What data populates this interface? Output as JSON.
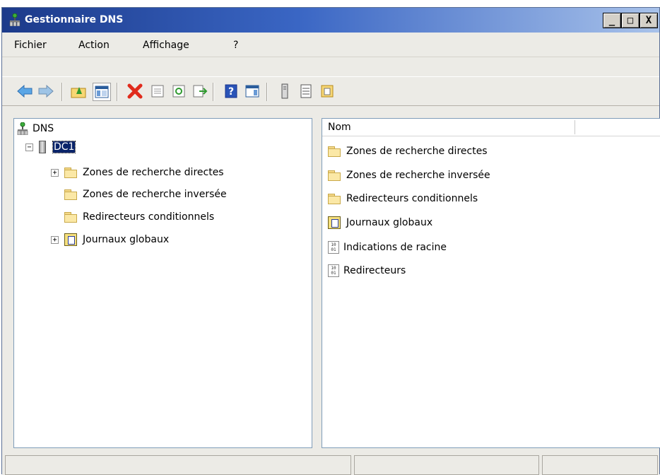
{
  "window": {
    "title": "Gestionnaire DNS",
    "buttons": {
      "minimize": "_",
      "maximize": "□",
      "close": "X"
    }
  },
  "menubar": {
    "items": [
      "Fichier",
      "Action",
      "Affichage",
      "?"
    ]
  },
  "toolbar": {
    "buttons": [
      "back-icon",
      "forward-icon",
      "up-folder-icon",
      "show-hide-tree-icon",
      "delete-icon",
      "properties-icon",
      "refresh-icon",
      "export-list-icon",
      "help-icon",
      "show-action-pane-icon",
      "server-icon",
      "list-view-icon",
      "new-window-icon"
    ]
  },
  "tree": {
    "root": "DNS",
    "server": "DC1",
    "items": [
      {
        "label": "Zones de recherche directes",
        "expandable": true
      },
      {
        "label": "Zones de recherche inversée",
        "expandable": false
      },
      {
        "label": "Redirecteurs conditionnels",
        "expandable": false
      },
      {
        "label": "Journaux globaux",
        "expandable": true
      }
    ]
  },
  "list": {
    "column": "Nom",
    "items": [
      {
        "label": "Zones de recherche directes",
        "icon": "folder-icon"
      },
      {
        "label": "Zones de recherche inversée",
        "icon": "folder-icon"
      },
      {
        "label": "Redirecteurs conditionnels",
        "icon": "folder-icon"
      },
      {
        "label": "Journaux globaux",
        "icon": "log-icon"
      },
      {
        "label": "Indications de racine",
        "icon": "binary-icon"
      },
      {
        "label": "Redirecteurs",
        "icon": "binary-icon"
      }
    ]
  },
  "colors": {
    "title_gradient_start": "#1c3a8a",
    "selection": "#0a246a",
    "delete_red": "#e02b1c"
  }
}
